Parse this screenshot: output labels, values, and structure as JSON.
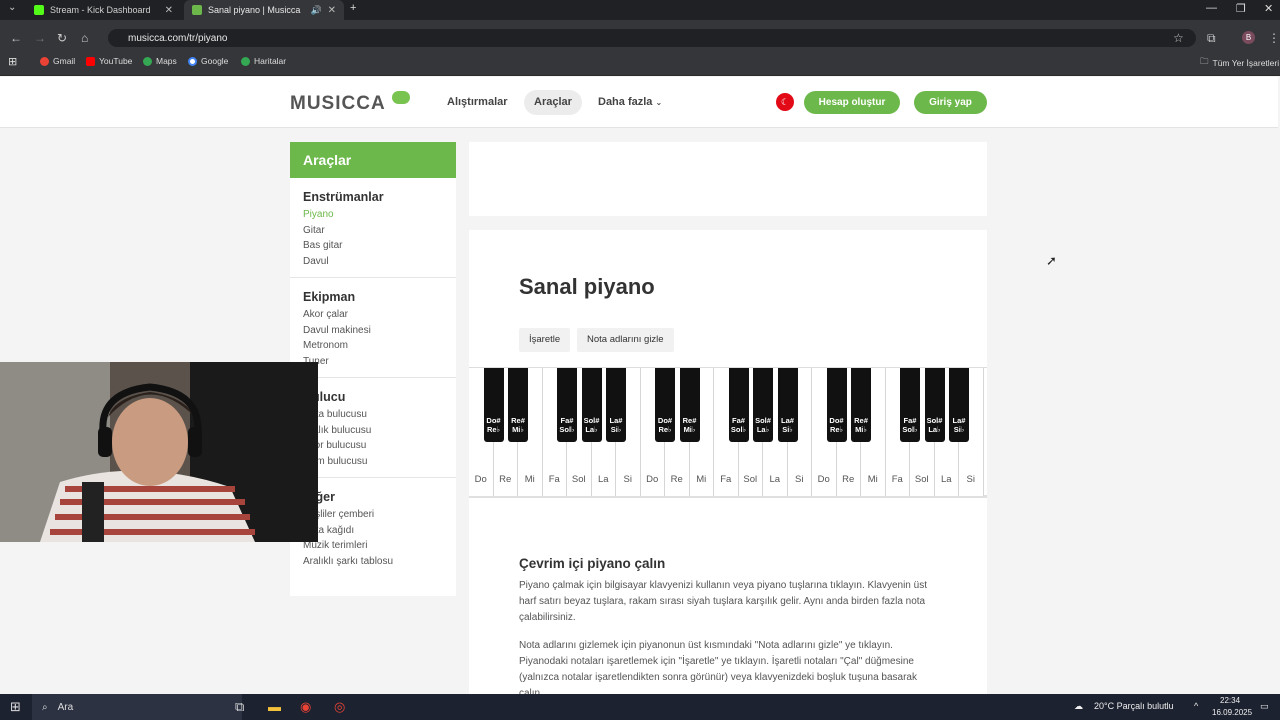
{
  "browser": {
    "tabs": [
      {
        "title": "Stream - Kick Dashboard"
      },
      {
        "title": "Sanal piyano | Musicca"
      }
    ],
    "url": "musicca.com/tr/piyano",
    "bookmarks": [
      "Gmail",
      "YouTube",
      "Maps",
      "Google",
      "Haritalar"
    ],
    "all_bookmarks": "Tüm Yer İşaretleri",
    "profile_initial": "B"
  },
  "header": {
    "logo": "MUSICCA",
    "nav": [
      "Alıştırmalar",
      "Araçlar",
      "Daha fazla"
    ],
    "create_account": "Hesap oluştur",
    "login": "Giriş yap"
  },
  "sidebar": {
    "title": "Araçlar",
    "groups": [
      {
        "heading": "Enstrümanlar",
        "items": [
          "Piyano",
          "Gitar",
          "Bas gitar",
          "Davul"
        ]
      },
      {
        "heading": "Ekipman",
        "items": [
          "Akor çalar",
          "Davul makinesi",
          "Metronom",
          "Tuner"
        ]
      },
      {
        "heading": "Bulucu",
        "items": [
          "Nota bulucusu",
          "Aralık bulucusu",
          "Akor bulucusu",
          "Gam bulucusu"
        ]
      },
      {
        "heading": "Diğer",
        "items": [
          "Beşliler çemberi",
          "Nota kağıdı",
          "Müzik terimleri",
          "Aralıklı şarkı tablosu"
        ]
      }
    ]
  },
  "main": {
    "title": "Sanal piyano",
    "mark_button": "İşaretle",
    "hide_names_button": "Nota adlarını gizle",
    "white_keys": [
      "Do",
      "Re",
      "Mi",
      "Fa",
      "Sol",
      "La",
      "Si",
      "Do",
      "Re",
      "Mi",
      "Fa",
      "Sol",
      "La",
      "Si",
      "Do",
      "Re",
      "Mi",
      "Fa",
      "Sol",
      "La",
      "Si"
    ],
    "black_keys": [
      "Do#\nRe♭",
      "Re#\nMi♭",
      "Fa#\nSol♭",
      "Sol#\nLa♭",
      "La#\nSi♭",
      "Do#\nRe♭",
      "Re#\nMi♭",
      "Fa#\nSol♭",
      "Sol#\nLa♭",
      "La#\nSi♭",
      "Do#\nRe♭",
      "Re#\nMi♭",
      "Fa#\nSol♭",
      "Sol#\nLa♭",
      "La#\nSi♭"
    ],
    "subtitle": "Çevrim içi piyano çalın",
    "para1": "Piyano çalmak için bilgisayar klavyenizi kullanın veya piyano tuşlarına tıklayın. Klavyenin üst harf satırı beyaz tuşlara, rakam sırası siyah tuşlara karşılık gelir. Aynı anda birden fazla nota çalabilirsiniz.",
    "para2": "Nota adlarını gizlemek için piyanonun üst kısmındaki \"Nota adlarını gizle\" ye tıklayın. Piyanodaki notaları işaretlemek için \"İşaretle\" ye tıklayın. İşaretli notaları \"Çal\" düğmesine (yalnızca notalar işaretlendikten sonra görünür) veya klavyenizdeki boşluk tuşuna basarak çalın."
  },
  "taskbar": {
    "search": "Ara",
    "weather": "20°C  Parçalı bulutlu",
    "time": "22:34",
    "date": "16.09.2025"
  },
  "colors": {
    "accent": "#6db84b",
    "chrome_dark": "#202124"
  }
}
